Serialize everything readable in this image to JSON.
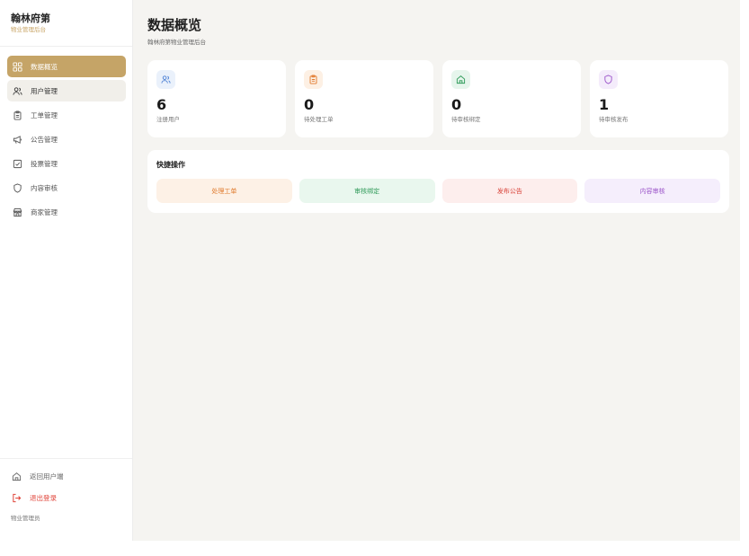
{
  "brand": {
    "name": "翰林府第",
    "subtitle": "物业管理后台"
  },
  "nav": {
    "items": [
      {
        "label": "数据概览",
        "icon": "grid-icon",
        "state": "active"
      },
      {
        "label": "用户管理",
        "icon": "users-icon",
        "state": "hover"
      },
      {
        "label": "工单管理",
        "icon": "clipboard-icon",
        "state": "normal"
      },
      {
        "label": "公告管理",
        "icon": "megaphone-icon",
        "state": "normal"
      },
      {
        "label": "投票管理",
        "icon": "checkbox-icon",
        "state": "normal"
      },
      {
        "label": "内容审核",
        "icon": "shield-icon",
        "state": "normal"
      },
      {
        "label": "商家管理",
        "icon": "store-icon",
        "state": "normal"
      }
    ]
  },
  "sidebar_bottom": {
    "back_label": "返回用户端",
    "logout_label": "退出登录",
    "role": "物业管理员"
  },
  "page": {
    "title": "数据概览",
    "subtitle": "翰林府第物业管理后台"
  },
  "stats": [
    {
      "value": "6",
      "label": "注册用户",
      "icon": "users-icon",
      "color": "#4a7fd4",
      "bg": "#eaf1fb"
    },
    {
      "value": "0",
      "label": "待处理工单",
      "icon": "clipboard-icon",
      "color": "#e27a2e",
      "bg": "#fdf0e4"
    },
    {
      "value": "0",
      "label": "待审核绑定",
      "icon": "home-icon",
      "color": "#2e9a58",
      "bg": "#e6f5ec"
    },
    {
      "value": "1",
      "label": "待审核发布",
      "icon": "shield-icon",
      "color": "#9b54c9",
      "bg": "#f4ecfb"
    }
  ],
  "quick": {
    "title": "快捷操作",
    "actions": [
      {
        "label": "处理工单",
        "color": "#e07a2c",
        "bg": "#fdf1e6"
      },
      {
        "label": "审核绑定",
        "color": "#2e9a58",
        "bg": "#e9f7ee"
      },
      {
        "label": "发布公告",
        "color": "#d9443a",
        "bg": "#fdeeed"
      },
      {
        "label": "内容审核",
        "color": "#9b54c9",
        "bg": "#f5eefc"
      }
    ]
  }
}
